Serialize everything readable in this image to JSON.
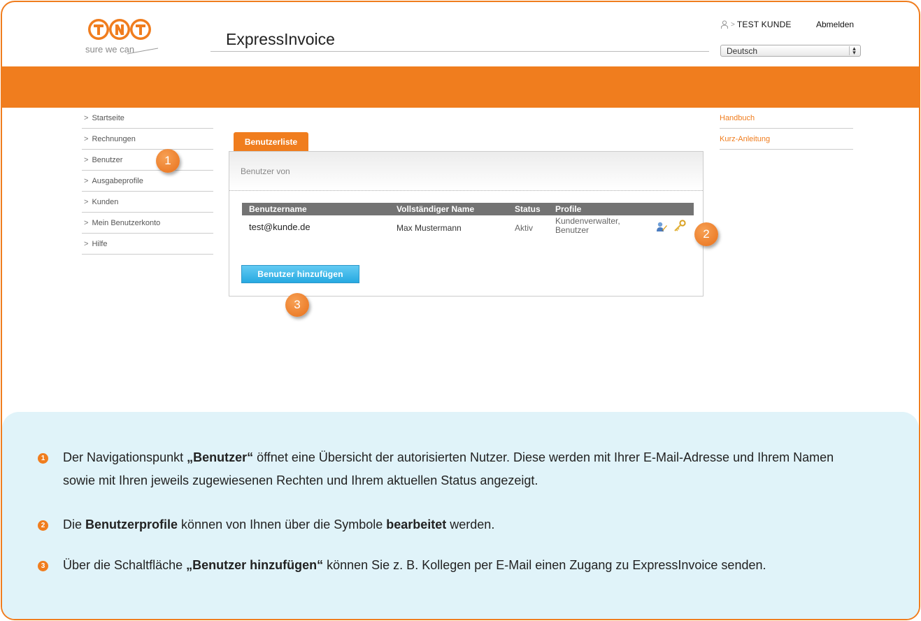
{
  "header": {
    "app_title": "ExpressInvoice",
    "logo_tagline": "sure we can",
    "user_name": "TEST KUNDE",
    "user_prefix": ">",
    "logout_label": "Abmelden",
    "language": "Deutsch"
  },
  "sidebar": {
    "items": [
      {
        "label": "Startseite"
      },
      {
        "label": "Rechnungen"
      },
      {
        "label": "Benutzer"
      },
      {
        "label": "Ausgabeprofile"
      },
      {
        "label": "Kunden"
      },
      {
        "label": "Mein Benutzerkonto"
      },
      {
        "label": "Hilfe"
      }
    ]
  },
  "right_links": [
    {
      "label": "Handbuch"
    },
    {
      "label": "Kurz-Anleitung"
    }
  ],
  "main": {
    "tab_label": "Benutzerliste",
    "panel_heading": "Benutzer von",
    "table": {
      "headers": [
        "Benutzername",
        "Vollständiger Name",
        "Status",
        "Profile"
      ],
      "rows": [
        {
          "username": "test@kunde.de",
          "full_name": "Max Mustermann",
          "status": "Aktiv",
          "profile_line1": "Kundenverwalter,",
          "profile_line2": "Benutzer"
        }
      ]
    },
    "add_button_label": "Benutzer hinzufügen"
  },
  "markers": [
    "1",
    "2",
    "3"
  ],
  "notes": [
    {
      "number": "1",
      "before": "Der Navigationspunkt ",
      "bold": "„Benutzer“",
      "after": " öffnet eine Übersicht der autorisierten Nutzer. Diese werden mit Ihrer E-Mail-Adresse und Ihrem Namen sowie mit Ihren jeweils zugewiesenen Rechten und Ihrem aktuellen Status angezeigt."
    },
    {
      "number": "2",
      "before": "Die ",
      "bold": "Benutzerprofile",
      "middle": " können von Ihnen über die Symbole ",
      "bold2": "bearbeitet",
      "after": " werden."
    },
    {
      "number": "3",
      "before": "Über die Schaltfläche ",
      "bold": "„Benutzer hinzufügen“",
      "after": " können Sie z. B. Kollegen per E-Mail einen Zugang zu ExpressInvoice senden."
    }
  ],
  "colors": {
    "brand_orange": "#f07d1e",
    "button_blue": "#26a9e1",
    "notes_background": "#e0f3f9"
  },
  "icons": {
    "user": "user-icon",
    "edit": "edit-user-icon",
    "key": "key-icon"
  }
}
